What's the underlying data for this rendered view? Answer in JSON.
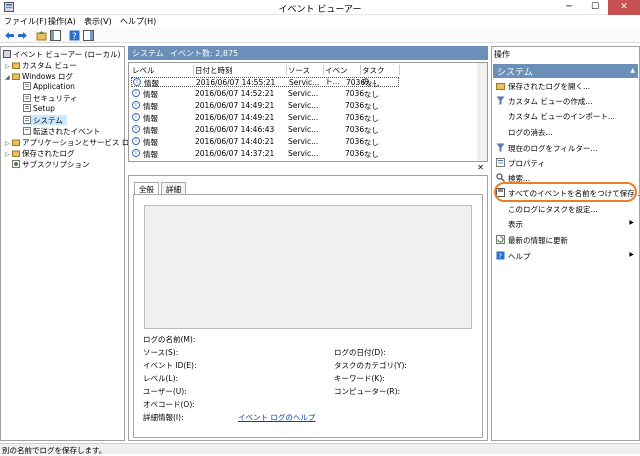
{
  "window": {
    "title": "イベント ビューアー",
    "min": "─",
    "max": "☐",
    "close": "✕"
  },
  "menu": [
    "ファイル(F)",
    "操作(A)",
    "表示(V)",
    "ヘルプ(H)"
  ],
  "tree": [
    {
      "label": "イベント ビューアー (ローカル)",
      "indent": 0,
      "expand": ""
    },
    {
      "label": "カスタム ビュー",
      "indent": 1,
      "expand": "▷"
    },
    {
      "label": "Windows ログ",
      "indent": 1,
      "expand": "◢"
    },
    {
      "label": "Application",
      "indent": 2,
      "expand": ""
    },
    {
      "label": "セキュリティ",
      "indent": 2,
      "expand": ""
    },
    {
      "label": "Setup",
      "indent": 2,
      "expand": ""
    },
    {
      "label": "システム",
      "indent": 2,
      "expand": "",
      "selected": true
    },
    {
      "label": "転送されたイベント",
      "indent": 2,
      "expand": ""
    },
    {
      "label": "アプリケーションとサービス ログ",
      "indent": 1,
      "expand": "▷"
    },
    {
      "label": "保存されたログ",
      "indent": 1,
      "expand": "▷"
    },
    {
      "label": "サブスクリプション",
      "indent": 1,
      "expand": ""
    }
  ],
  "center": {
    "log_name": "システム",
    "count_label": "イベント数: 2,875"
  },
  "columns": [
    "レベル",
    "日付と時刻",
    "ソース",
    "イベント...",
    "タスクの..."
  ],
  "rows": [
    {
      "level": "情報",
      "date": "2016/06/07 14:55:21",
      "source": "Servic...",
      "id": "7036",
      "task": "なし"
    },
    {
      "level": "情報",
      "date": "2016/06/07 14:52:21",
      "source": "Servic...",
      "id": "7036",
      "task": "なし"
    },
    {
      "level": "情報",
      "date": "2016/06/07 14:49:21",
      "source": "Servic...",
      "id": "7036",
      "task": "なし"
    },
    {
      "level": "情報",
      "date": "2016/06/07 14:49:21",
      "source": "Servic...",
      "id": "7036",
      "task": "なし"
    },
    {
      "level": "情報",
      "date": "2016/06/07 14:46:43",
      "source": "Servic...",
      "id": "7036",
      "task": "なし"
    },
    {
      "level": "情報",
      "date": "2016/06/07 14:40:21",
      "source": "Servic...",
      "id": "7036",
      "task": "なし"
    },
    {
      "level": "情報",
      "date": "2016/06/07 14:37:21",
      "source": "Servic...",
      "id": "7036",
      "task": "なし"
    }
  ],
  "detail": {
    "close": "✕",
    "tabs": [
      "全般",
      "詳細"
    ],
    "fields_left": [
      "ログの名前(M):",
      "ソース(S):",
      "イベント ID(E):",
      "レベル(L):",
      "ユーザー(U):",
      "オペコード(O):",
      "詳細情報(I):"
    ],
    "fields_right": [
      "ログの日付(D):",
      "タスクのカテゴリ(Y):",
      "キーワード(K):",
      "コンピューター(R):"
    ],
    "help_link": "イベント ログのヘルプ"
  },
  "actions": {
    "title": "操作",
    "section": "システム",
    "items": [
      {
        "label": "保存されたログを開く...",
        "icon": "folder-open-icon"
      },
      {
        "label": "カスタム ビューの作成...",
        "icon": "filter-create-icon"
      },
      {
        "label": "カスタム ビューのインポート...",
        "icon": ""
      },
      {
        "label": "ログの消去...",
        "icon": ""
      },
      {
        "label": "現在のログをフィルター...",
        "icon": "filter-icon"
      },
      {
        "label": "プロパティ",
        "icon": "properties-icon"
      },
      {
        "label": "検索...",
        "icon": "search-icon"
      },
      {
        "label": "すべてのイベントを名前をつけて保存...",
        "icon": "save-icon"
      },
      {
        "label": "このログにタスクを設定...",
        "icon": ""
      },
      {
        "label": "表示",
        "icon": "",
        "arrow": true
      },
      {
        "label": "最新の情報に更新",
        "icon": "refresh-icon"
      },
      {
        "label": "ヘルプ",
        "icon": "help-icon",
        "arrow": true
      }
    ]
  },
  "status": "別の名前でログを保存します。",
  "colors": {
    "header": "#6b8fb8",
    "highlight": "#e8802a",
    "selection": "#cce8ff"
  }
}
